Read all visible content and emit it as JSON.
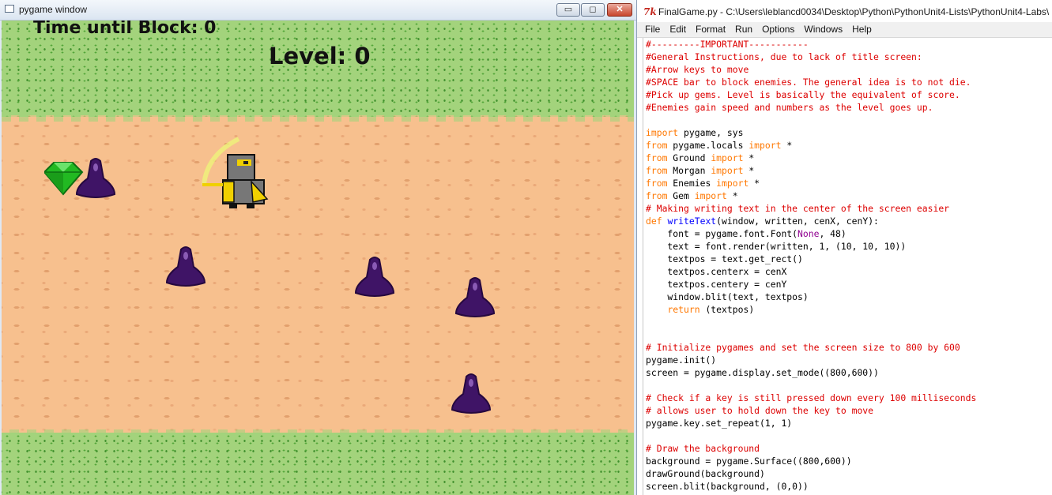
{
  "pygame_window": {
    "title": "pygame window",
    "buttons": {
      "minimize": "▭",
      "maximize": "◻",
      "close": "✕"
    },
    "hud": {
      "timer_text": "Time until Block: 0",
      "level_text": "Level: 0"
    },
    "colors": {
      "grass": "#a3d37c",
      "grass_dots": "#54a63a",
      "dirt": "#f7c08e",
      "enemy": "#3f1466",
      "gem": "#22b922",
      "player_armor": "#777777",
      "player_gold": "#f0d000"
    }
  },
  "idle_window": {
    "title": "FinalGame.py - C:\\Users\\leblancd0034\\Desktop\\Python\\PythonUnit4-Lists\\PythonUnit4-Labs\\",
    "tk_icon": "7k",
    "menus": [
      "File",
      "Edit",
      "Format",
      "Run",
      "Options",
      "Windows",
      "Help"
    ],
    "code_lines": [
      [
        [
          "cm",
          "#---------IMPORTANT-----------"
        ]
      ],
      [
        [
          "cm",
          "#General Instructions, due to lack of title screen:"
        ]
      ],
      [
        [
          "cm",
          "#Arrow keys to move"
        ]
      ],
      [
        [
          "cm",
          "#SPACE bar to block enemies. The general idea is to not die."
        ]
      ],
      [
        [
          "cm",
          "#Pick up gems. Level is basically the equivalent of score."
        ]
      ],
      [
        [
          "cm",
          "#Enemies gain speed and numbers as the level goes up."
        ]
      ],
      [],
      [
        [
          "kw",
          "import"
        ],
        [
          "",
          " pygame, sys"
        ]
      ],
      [
        [
          "kw",
          "from"
        ],
        [
          "",
          " pygame.locals "
        ],
        [
          "kw",
          "import"
        ],
        [
          "",
          " *"
        ]
      ],
      [
        [
          "kw",
          "from"
        ],
        [
          "",
          " Ground "
        ],
        [
          "kw",
          "import"
        ],
        [
          "",
          " *"
        ]
      ],
      [
        [
          "kw",
          "from"
        ],
        [
          "",
          " Morgan "
        ],
        [
          "kw",
          "import"
        ],
        [
          "",
          " *"
        ]
      ],
      [
        [
          "kw",
          "from"
        ],
        [
          "",
          " Enemies "
        ],
        [
          "kw",
          "import"
        ],
        [
          "",
          " *"
        ]
      ],
      [
        [
          "kw",
          "from"
        ],
        [
          "",
          " Gem "
        ],
        [
          "kw",
          "import"
        ],
        [
          "",
          " *"
        ]
      ],
      [
        [
          "cm",
          "# Making writing text in the center of the screen easier"
        ]
      ],
      [
        [
          "kw",
          "def"
        ],
        [
          "",
          " "
        ],
        [
          "fn",
          "writeText"
        ],
        [
          "",
          "(window, written, cenX, cenY):"
        ]
      ],
      [
        [
          "",
          "    font = pygame.font.Font("
        ],
        [
          "bi",
          "None"
        ],
        [
          "",
          ", 48)"
        ]
      ],
      [
        [
          "",
          "    text = font.render(written, 1, (10, 10, 10))"
        ]
      ],
      [
        [
          "",
          "    textpos = text.get_rect()"
        ]
      ],
      [
        [
          "",
          "    textpos.centerx = cenX"
        ]
      ],
      [
        [
          "",
          "    textpos.centery = cenY"
        ]
      ],
      [
        [
          "",
          "    window.blit(text, textpos)"
        ]
      ],
      [
        [
          "",
          "    "
        ],
        [
          "kw",
          "return"
        ],
        [
          "",
          " (textpos)"
        ]
      ],
      [],
      [],
      [
        [
          "cm",
          "# Initialize pygames and set the screen size to 800 by 600"
        ]
      ],
      [
        [
          "",
          "pygame.init()"
        ]
      ],
      [
        [
          "",
          "screen = pygame.display.set_mode((800,600))"
        ]
      ],
      [],
      [
        [
          "cm",
          "# Check if a key is still pressed down every 100 milliseconds"
        ]
      ],
      [
        [
          "cm",
          "# allows user to hold down the key to move"
        ]
      ],
      [
        [
          "",
          "pygame.key.set_repeat(1, 1)"
        ]
      ],
      [],
      [
        [
          "cm",
          "# Draw the background"
        ]
      ],
      [
        [
          "",
          "background = pygame.Surface((800,600))"
        ]
      ],
      [
        [
          "",
          "drawGround(background)"
        ]
      ],
      [
        [
          "",
          "screen.blit(background, (0,0))"
        ]
      ]
    ]
  }
}
